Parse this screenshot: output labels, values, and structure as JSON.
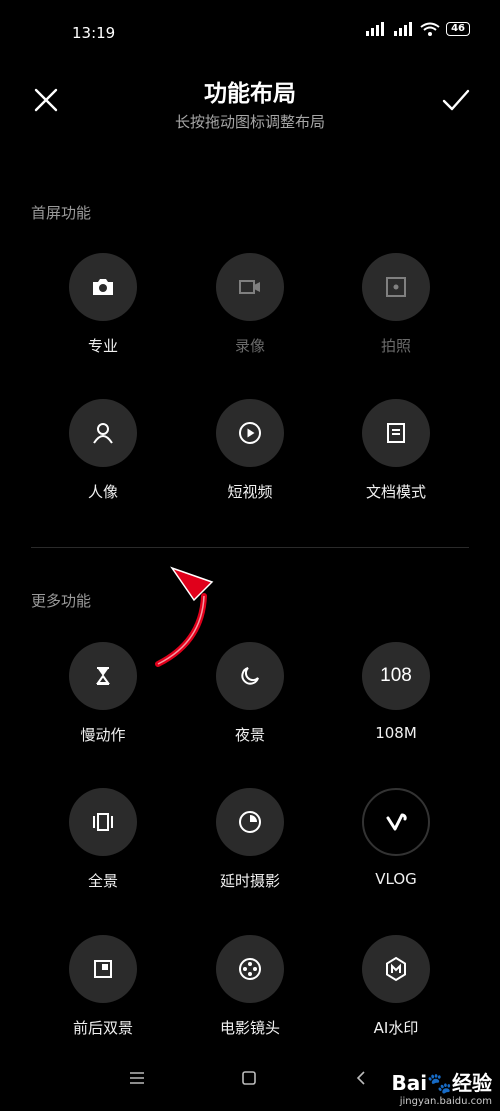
{
  "status": {
    "time": "13:19",
    "battery": "46"
  },
  "header": {
    "title": "功能布局",
    "subtitle": "长按拖动图标调整布局"
  },
  "sections": {
    "home": {
      "title": "首屏功能",
      "items": [
        {
          "label": "专业",
          "icon": "camera-icon",
          "dim": false
        },
        {
          "label": "录像",
          "icon": "video-icon",
          "dim": true
        },
        {
          "label": "拍照",
          "icon": "shutter-icon",
          "dim": true
        },
        {
          "label": "人像",
          "icon": "portrait-icon",
          "dim": false
        },
        {
          "label": "短视频",
          "icon": "play-icon",
          "dim": false
        },
        {
          "label": "文档模式",
          "icon": "document-icon",
          "dim": false
        }
      ]
    },
    "more": {
      "title": "更多功能",
      "items": [
        {
          "label": "慢动作",
          "icon": "hourglass-icon"
        },
        {
          "label": "夜景",
          "icon": "moon-icon"
        },
        {
          "label": "108M",
          "icon": "108-icon",
          "icon_text": "108"
        },
        {
          "label": "全景",
          "icon": "panorama-icon"
        },
        {
          "label": "延时摄影",
          "icon": "timelapse-icon"
        },
        {
          "label": "VLOG",
          "icon": "vlog-icon"
        },
        {
          "label": "前后双景",
          "icon": "dual-view-icon"
        },
        {
          "label": "电影镜头",
          "icon": "film-reel-icon"
        },
        {
          "label": "AI水印",
          "icon": "ai-watermark-icon"
        }
      ]
    }
  },
  "watermark": {
    "brand": "Bai",
    "brand2": "经验",
    "url": "jingyan.baidu.com"
  },
  "colors": {
    "background": "#000000",
    "tile": "#2b2b2b",
    "arrow": "#e0001b"
  }
}
